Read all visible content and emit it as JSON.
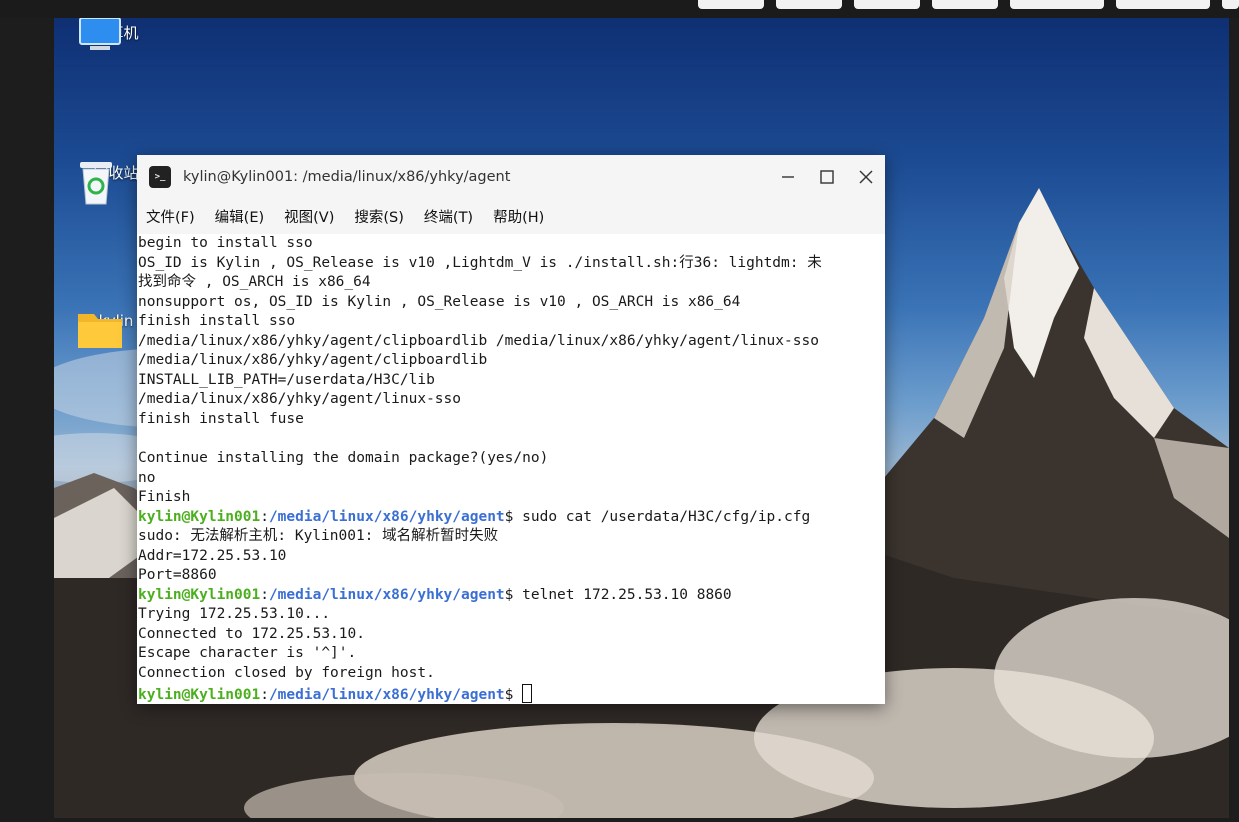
{
  "desktop": {
    "icons": [
      {
        "label": "计算机",
        "icon": "computer-icon"
      },
      {
        "label": "回收站",
        "icon": "trash-icon"
      },
      {
        "label": "kylin",
        "icon": "folder-icon"
      }
    ]
  },
  "terminal": {
    "title": "kylin@Kylin001: /media/linux/x86/yhky/agent",
    "icon": "terminal-app-icon",
    "window_buttons": [
      "minimize-icon",
      "maximize-icon",
      "close-icon"
    ],
    "menu": [
      "文件(F)",
      "编辑(E)",
      "视图(V)",
      "搜索(S)",
      "终端(T)",
      "帮助(H)"
    ],
    "prompt_user": "kylin@Kylin001",
    "prompt_path": "/media/linux/x86/yhky/agent",
    "lines": [
      {
        "kind": "text",
        "text": "begin to install sso"
      },
      {
        "kind": "text",
        "text": "OS_ID is Kylin , OS_Release is v10 ,Lightdm_V is ./install.sh:行36: lightdm: 未"
      },
      {
        "kind": "text",
        "text": "找到命令 , OS_ARCH is x86_64"
      },
      {
        "kind": "text",
        "text": "nonsupport os, OS_ID is Kylin , OS_Release is v10 , OS_ARCH is x86_64"
      },
      {
        "kind": "text",
        "text": "finish install sso"
      },
      {
        "kind": "text",
        "text": "/media/linux/x86/yhky/agent/clipboardlib /media/linux/x86/yhky/agent/linux-sso"
      },
      {
        "kind": "text",
        "text": "/media/linux/x86/yhky/agent/clipboardlib"
      },
      {
        "kind": "text",
        "text": "INSTALL_LIB_PATH=/userdata/H3C/lib"
      },
      {
        "kind": "text",
        "text": "/media/linux/x86/yhky/agent/linux-sso"
      },
      {
        "kind": "text",
        "text": "finish install fuse"
      },
      {
        "kind": "text",
        "text": ""
      },
      {
        "kind": "text",
        "text": "Continue installing the domain package?(yes/no)"
      },
      {
        "kind": "text",
        "text": "no"
      },
      {
        "kind": "text",
        "text": "Finish"
      },
      {
        "kind": "prompt",
        "user": "kylin@Kylin001",
        "path": "/media/linux/x86/yhky/agent",
        "cmd": "sudo cat /userdata/H3C/cfg/ip.cfg"
      },
      {
        "kind": "text",
        "text": "sudo: 无法解析主机: Kylin001: 域名解析暂时失败"
      },
      {
        "kind": "text",
        "text": "Addr=172.25.53.10"
      },
      {
        "kind": "text",
        "text": "Port=8860"
      },
      {
        "kind": "prompt",
        "user": "kylin@Kylin001",
        "path": "/media/linux/x86/yhky/agent",
        "cmd": "telnet 172.25.53.10 8860"
      },
      {
        "kind": "text",
        "text": "Trying 172.25.53.10..."
      },
      {
        "kind": "text",
        "text": "Connected to 172.25.53.10."
      },
      {
        "kind": "text",
        "text": "Escape character is '^]'."
      },
      {
        "kind": "text",
        "text": "Connection closed by foreign host."
      },
      {
        "kind": "prompt",
        "user": "kylin@Kylin001",
        "path": "/media/linux/x86/yhky/agent",
        "cmd": "",
        "cursor": true
      }
    ]
  },
  "colors": {
    "prompt_user": "#4caf1e",
    "prompt_path": "#3b6fd3",
    "terminal_bg": "#ffffff",
    "titlebar_bg": "#f5f5f5"
  }
}
